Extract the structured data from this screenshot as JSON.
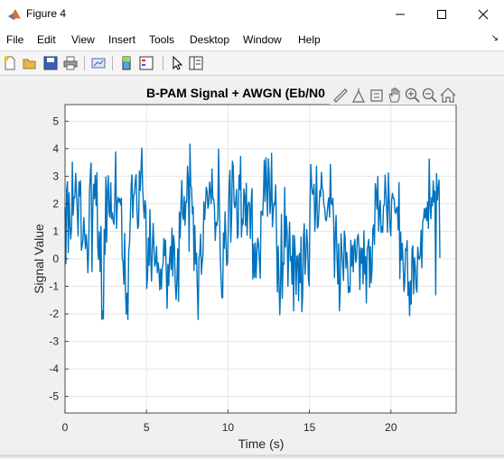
{
  "window": {
    "title": "Figure 4",
    "controls": {
      "minimize": "minimize",
      "maximize": "maximize",
      "close": "close"
    }
  },
  "menu": {
    "items": [
      "File",
      "Edit",
      "View",
      "Insert",
      "Tools",
      "Desktop",
      "Window",
      "Help"
    ],
    "overflow_arrow": "↘"
  },
  "toolbar": {
    "icons": [
      "new-figure-icon",
      "open-file-icon",
      "save-icon",
      "print-icon",
      "link-plot-icon",
      "insert-colorbar-icon",
      "insert-legend-icon",
      "edit-plot-icon",
      "property-inspector-icon"
    ]
  },
  "axes_toolbar": {
    "icons": [
      "brush-icon",
      "data-cursor-icon",
      "rotate-icon",
      "pan-icon",
      "zoom-in-icon",
      "zoom-out-icon",
      "home-icon"
    ]
  },
  "colors": {
    "line": "#0072bd",
    "grid": "#e6e6e6",
    "axes_background": "#ffffff",
    "figure_background": "#f0f0f0"
  },
  "chart_data": {
    "type": "line",
    "title": "B-PAM Signal + AWGN (Eb/N0",
    "xlabel": "Time (s)",
    "ylabel": "Signal Value",
    "xlim": [
      0,
      24
    ],
    "ylim": [
      -5.6,
      5.6
    ],
    "xticks": [
      0,
      5,
      10,
      15,
      20
    ],
    "yticks": [
      5,
      4,
      3,
      2,
      1,
      0,
      -1,
      -2,
      -3,
      -4,
      -5
    ],
    "grid": true,
    "series": [
      {
        "color": "#0072bd",
        "x_start": 0,
        "x_end": 23,
        "num_points": 460,
        "symbol_duration": 0.5,
        "symbol_levels": [
          2,
          2,
          0,
          2,
          0,
          2,
          2,
          0,
          2,
          2,
          0,
          0,
          0,
          0,
          2,
          2,
          0,
          2,
          2,
          0,
          2,
          2,
          2,
          0,
          2,
          2,
          0,
          0,
          0,
          0,
          2,
          2,
          2,
          0,
          0,
          0,
          0,
          0,
          2,
          2,
          2,
          0,
          0,
          0,
          2,
          2
        ],
        "noise_std": 0.95,
        "value_range": [
          -2.2,
          4.6
        ]
      }
    ]
  }
}
